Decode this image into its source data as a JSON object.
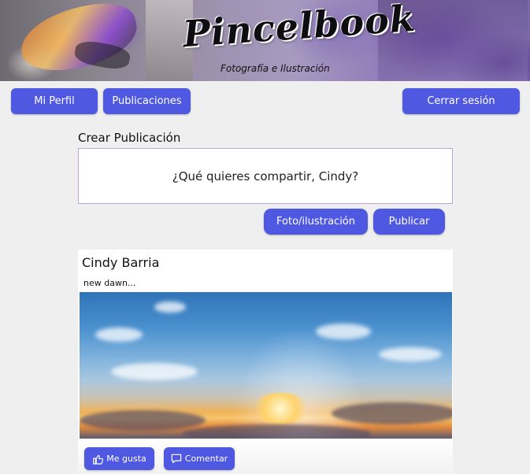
{
  "header": {
    "brand": "Pincelbook",
    "tagline": "Fotografía e Ilustración"
  },
  "nav": {
    "profile_label": "Mi Perfil",
    "posts_label": "Publicaciones",
    "logout_label": "Cerrar sesión"
  },
  "create_post": {
    "title": "Crear Publicación",
    "prompt": "¿Qué quieres compartir, Cindy?",
    "photo_button": "Foto/ilustración",
    "publish_button": "Publicar"
  },
  "post": {
    "author": "Cindy Barria",
    "text": "new dawn...",
    "like_label": "Me gusta",
    "comment_label": "Comentar"
  },
  "colors": {
    "accent": "#4f58e0",
    "background": "#efefef"
  }
}
